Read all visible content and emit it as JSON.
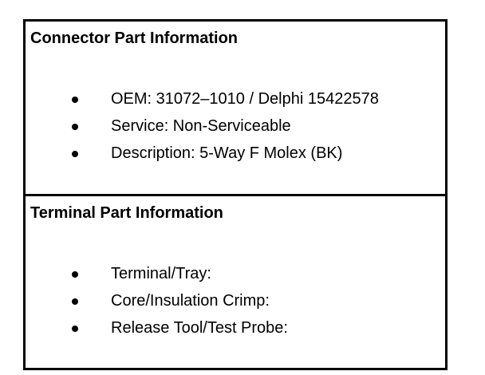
{
  "connector": {
    "title": "Connector Part Information",
    "items": [
      "OEM: 31072–1010 / Delphi 15422578",
      "Service: Non-Serviceable",
      "Description: 5-Way F Molex (BK)"
    ]
  },
  "terminal": {
    "title": "Terminal Part Information",
    "items": [
      "Terminal/Tray:",
      "Core/Insulation Crimp:",
      "Release Tool/Test Probe:"
    ]
  }
}
